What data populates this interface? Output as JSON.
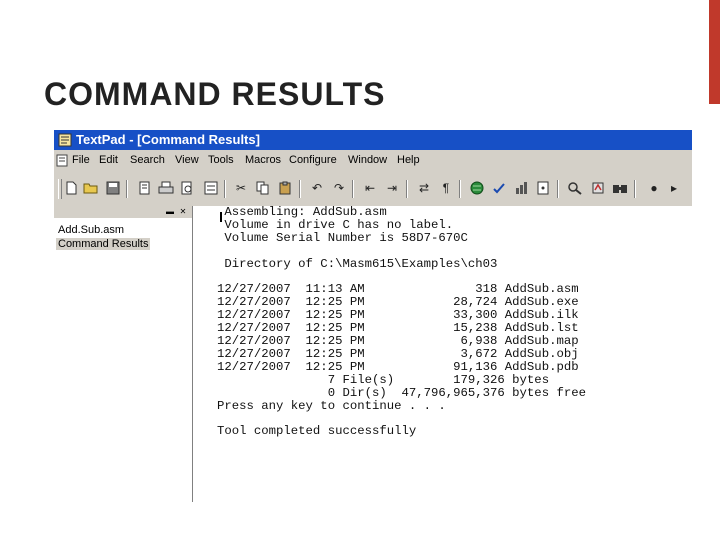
{
  "slide": {
    "title": "COMMAND RESULTS"
  },
  "window": {
    "title": "TextPad - [Command Results]",
    "menu": [
      "File",
      "Edit",
      "Search",
      "View",
      "Tools",
      "Macros",
      "Configure",
      "Window",
      "Help"
    ]
  },
  "toolbar": {
    "icons": [
      "new-file-icon",
      "open-folder-icon",
      "save-icon",
      "save-all-icon",
      "print-icon",
      "print-preview-icon",
      "spelling-icon",
      "cut-icon",
      "copy-icon",
      "paste-icon",
      "undo-icon",
      "redo-icon",
      "decrease-indent-icon",
      "increase-indent-icon",
      "word-wrap-icon",
      "pilcrow-icon",
      "web-icon",
      "spell-check-icon",
      "statistics-icon",
      "view-whitespace-icon",
      "find-icon",
      "tool-icon",
      "record-macro-icon",
      "play-macro-icon"
    ]
  },
  "document_selector": {
    "items": [
      "Add.Sub.asm",
      "Command Results"
    ],
    "selected": "Command Results"
  },
  "output": {
    "lines": [
      " Assembling: AddSub.asm",
      " Volume in drive C has no label.",
      " Volume Serial Number is 58D7-670C",
      "",
      " Directory of C:\\Masm615\\Examples\\ch03",
      "",
      "12/27/2007  11:13 AM               318 AddSub.asm",
      "12/27/2007  12:25 PM            28,724 AddSub.exe",
      "12/27/2007  12:25 PM            33,300 AddSub.ilk",
      "12/27/2007  12:25 PM            15,238 AddSub.lst",
      "12/27/2007  12:25 PM             6,938 AddSub.map",
      "12/27/2007  12:25 PM             3,672 AddSub.obj",
      "12/27/2007  12:25 PM            91,136 AddSub.pdb",
      "               7 File(s)        179,326 bytes",
      "               0 Dir(s)  47,796,965,376 bytes free",
      "Press any key to continue . . .",
      "",
      "Tool completed successfully"
    ]
  },
  "colors": {
    "titlebar": "#1750c6",
    "accent_bar": "#c0392b",
    "chrome": "#d4d0c8"
  }
}
